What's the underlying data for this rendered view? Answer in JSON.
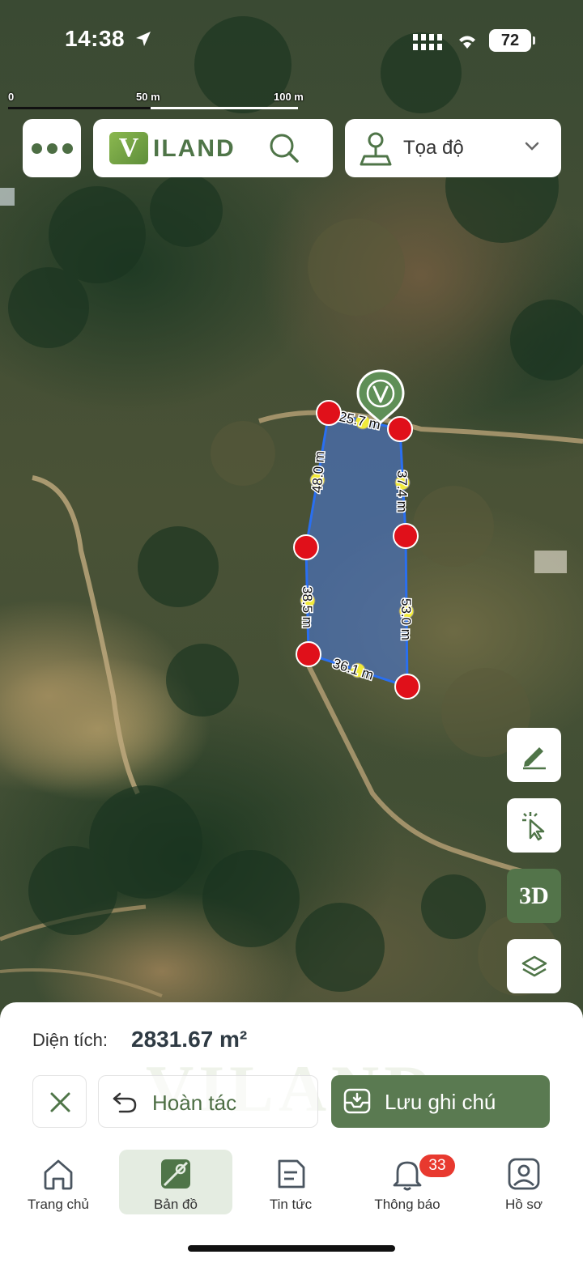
{
  "status_bar": {
    "time": "14:38",
    "battery": "72"
  },
  "map": {
    "scale": {
      "label_0": "0",
      "label_50": "50 m",
      "label_100": "100 m"
    },
    "edge_labels": [
      "25.7 m",
      "37.4 m",
      "53.0 m",
      "36.1 m",
      "38.5 m",
      "48.0 m"
    ]
  },
  "top_bar": {
    "logo_mark": "V",
    "logo_text": "ILAND",
    "coord_label": "Tọa độ"
  },
  "tools": {
    "three_d_label": "3D"
  },
  "sheet": {
    "area_label": "Diện tích:",
    "area_value": "2831.67 m²",
    "watermark": "VILAND",
    "undo_label": "Hoàn tác",
    "save_label": "Lưu ghi chú"
  },
  "tabs": [
    {
      "label": "Trang chủ"
    },
    {
      "label": "Bản đồ"
    },
    {
      "label": "Tin tức"
    },
    {
      "label": "Thông báo"
    },
    {
      "label": "Hồ sơ"
    }
  ],
  "notification_count": "33",
  "colors": {
    "brand_green": "#53744a",
    "vertex_red": "#e0101a",
    "polygon_fill": "#4a70b8",
    "badge_red": "#e8392f"
  }
}
